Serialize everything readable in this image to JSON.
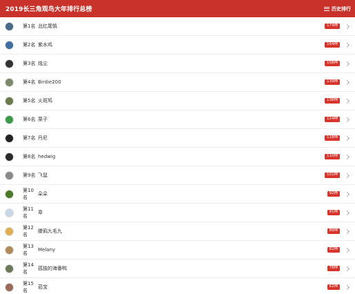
{
  "header": {
    "title": "2019长三角观鸟大年排行总榜",
    "history_label": "历史排行"
  },
  "colors": {
    "header_bg": "#c9322b",
    "badge_bg": "#d9342b"
  },
  "rows": [
    {
      "rank": "第1名",
      "name": "北红尾鸲",
      "count": "174种",
      "avatar_color": "#4a6a8a"
    },
    {
      "rank": "第2名",
      "name": "紫水鸡",
      "count": "164种",
      "avatar_color": "#3f6f9f"
    },
    {
      "rank": "第3名",
      "name": "烛尘",
      "count": "158种",
      "avatar_color": "#333333"
    },
    {
      "rank": "第4名",
      "name": "Birdie200",
      "count": "139种",
      "avatar_color": "#7a8a6a"
    },
    {
      "rank": "第5名",
      "name": "火斑鸠",
      "count": "138种",
      "avatar_color": "#6a7a4a"
    },
    {
      "rank": "第6名",
      "name": "栗子",
      "count": "124种",
      "avatar_color": "#3a9a4a"
    },
    {
      "rank": "第7名",
      "name": "丹尼",
      "count": "118种",
      "avatar_color": "#222222"
    },
    {
      "rank": "第8名",
      "name": "hedwig",
      "count": "110种",
      "avatar_color": "#2a2a2a"
    },
    {
      "rank": "第9名",
      "name": "飞鼠",
      "count": "101种",
      "avatar_color": "#8a8a8a"
    },
    {
      "rank": "第10名",
      "name": "朵朵",
      "count": "92种",
      "avatar_color": "#4a7a2a"
    },
    {
      "rank": "第11名",
      "name": "章",
      "count": "91种",
      "avatar_color": "#c8d8e8"
    },
    {
      "rank": "第12名",
      "name": "滕鸦九毛九",
      "count": "89种",
      "avatar_color": "#e0b050"
    },
    {
      "rank": "第13名",
      "name": "Melany",
      "count": "82种",
      "avatar_color": "#b08a5a"
    },
    {
      "rank": "第14名",
      "name": "孤独的海番鸭",
      "count": "78种",
      "avatar_color": "#6a7a5a"
    },
    {
      "rank": "第15名",
      "name": "茹宝",
      "count": "62种",
      "avatar_color": "#9a6a5a"
    }
  ]
}
